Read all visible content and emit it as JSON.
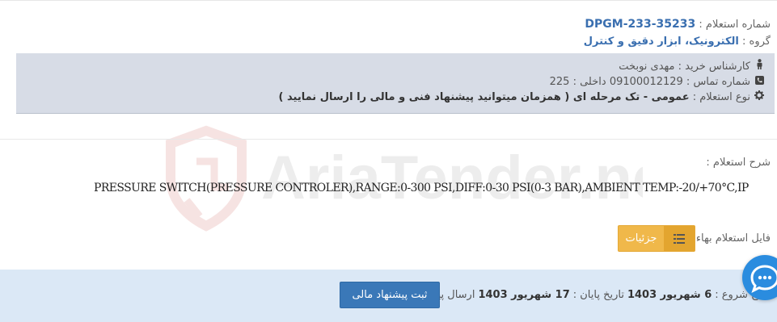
{
  "header": {
    "inquiry_number_label": "شماره استعلام :",
    "inquiry_number": "DPGM-233-35233",
    "group_label": "گروه :",
    "group_value": "الکترونیک، ابزار دقیق و کنترل"
  },
  "info": {
    "buyer_expert": "کارشناس خرید : مهدی نوبخت",
    "contact": "شماره تماس : 09100012129 داخلی : 225",
    "inquiry_type_label": "نوع استعلام :",
    "inquiry_type_value": "عمومی - تک مرحله ای ( همزمان میتوانید پیشنهاد فنی و مالی را ارسال نمایید )"
  },
  "description": {
    "label": "شرح استعلام :",
    "text": "PRESSURE SWITCH(PRESSURE CONTROLER),RANGE:0-300 PSI,DIFF:0-30 PSI(0-3 BAR),AMBIENT TEMP:-20/+70°C,IP"
  },
  "file": {
    "label": "فایل استعلام بهاء :",
    "details_label": "جزئیات"
  },
  "footer": {
    "start_label": "یخ شروع :",
    "start_value": "6 شهریور 1403",
    "end_label": "تاریخ پایان :",
    "end_value": "17 شهریور 1403",
    "send_label": "ارسال پیشنهاد :",
    "submit_label": "ثبت پیشنهاد مالی"
  },
  "watermark_text": "AriaTender.neT",
  "colors": {
    "accent": "#3a6fb0",
    "panel": "#d7dce6",
    "details_button": "#f0b84a",
    "submit_button": "#3a78b8",
    "footer": "#dbe8f6",
    "chat": "#2a8cdf"
  },
  "icons": {
    "buyer": "user-icon",
    "phone": "phone-icon",
    "type": "gear-icon",
    "details": "list-icon",
    "send": "cloud-upload-icon",
    "chat": "chat-icon"
  }
}
